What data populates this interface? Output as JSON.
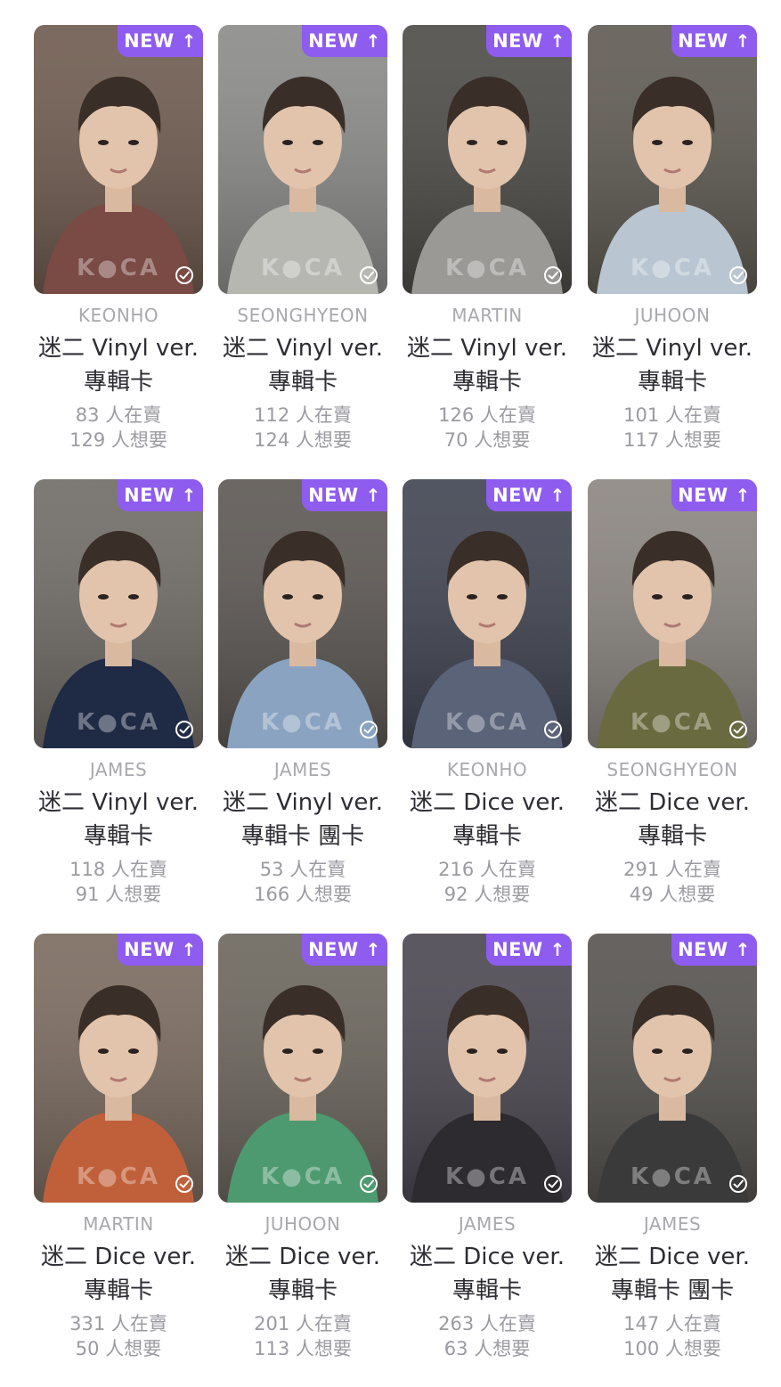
{
  "badge": {
    "label": "NEW",
    "arrow": "↑"
  },
  "watermark": "K●CA",
  "cards": [
    {
      "member": "KEONHO",
      "title1": "迷二 Vinyl ver.",
      "title2": "專輯卡",
      "sellers": "83 人在賣",
      "wants": "129 人想要",
      "bg": "#6e5a4e",
      "shirt": "#7a4a44"
    },
    {
      "member": "SEONGHYEON",
      "title1": "迷二 Vinyl ver.",
      "title2": "專輯卡",
      "sellers": "112 人在賣",
      "wants": "124 人想要",
      "bg": "#8a8a88",
      "shirt": "#b7b7b2"
    },
    {
      "member": "MARTIN",
      "title1": "迷二 Vinyl ver.",
      "title2": "專輯卡",
      "sellers": "126 人在賣",
      "wants": "70 人想要",
      "bg": "#4c4a46",
      "shirt": "#9a9996"
    },
    {
      "member": "JUHOON",
      "title1": "迷二 Vinyl ver.",
      "title2": "專輯卡",
      "sellers": "101 人在賣",
      "wants": "117 人想要",
      "bg": "#5e5a52",
      "shirt": "#b9c6d2"
    },
    {
      "member": "JAMES",
      "title1": "迷二 Vinyl ver.",
      "title2": "專輯卡",
      "sellers": "118 人在賣",
      "wants": "91 人想要",
      "bg": "#6f6b66",
      "shirt": "#1f2a44"
    },
    {
      "member": "JAMES",
      "title1": "迷二 Vinyl ver.",
      "title2": "專輯卡 團卡",
      "sellers": "53 人在賣",
      "wants": "166 人想要",
      "bg": "#5b5652",
      "shirt": "#8aa3c0"
    },
    {
      "member": "KEONHO",
      "title1": "迷二 Dice ver.",
      "title2": "專輯卡",
      "sellers": "216 人在賣",
      "wants": "92 人想要",
      "bg": "#3f4350",
      "shirt": "#5a6378"
    },
    {
      "member": "SEONGHYEON",
      "title1": "迷二 Dice ver.",
      "title2": "專輯卡",
      "sellers": "291 人在賣",
      "wants": "49 人想要",
      "bg": "#8a8580",
      "shirt": "#6a6a40"
    },
    {
      "member": "MARTIN",
      "title1": "迷二 Dice ver.",
      "title2": "專輯卡",
      "sellers": "331 人在賣",
      "wants": "50 人想要",
      "bg": "#7a6a5e",
      "shirt": "#c0603a"
    },
    {
      "member": "JUHOON",
      "title1": "迷二 Dice ver.",
      "title2": "專輯卡",
      "sellers": "201 人在賣",
      "wants": "113 人想要",
      "bg": "#6a655c",
      "shirt": "#4e9a70"
    },
    {
      "member": "JAMES",
      "title1": "迷二 Dice ver.",
      "title2": "專輯卡",
      "sellers": "263 人在賣",
      "wants": "63 人想要",
      "bg": "#4a4650",
      "shirt": "#2d2a30"
    },
    {
      "member": "JAMES",
      "title1": "迷二 Dice ver.",
      "title2": "專輯卡 團卡",
      "sellers": "147 人在賣",
      "wants": "100 人想要",
      "bg": "#55524e",
      "shirt": "#3a3a3a"
    }
  ]
}
